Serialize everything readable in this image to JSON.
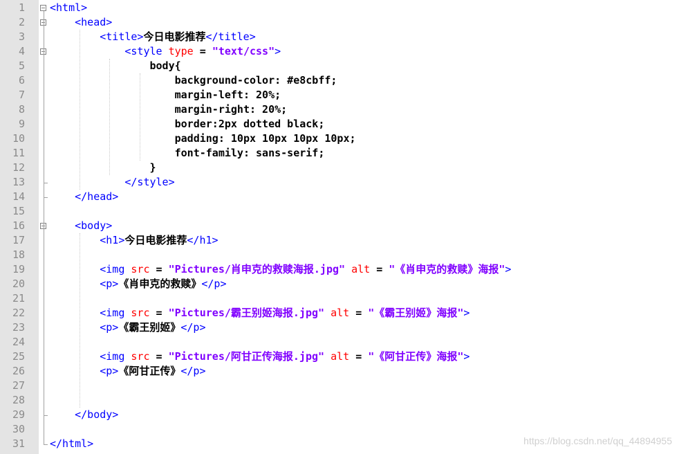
{
  "editor": {
    "lines": [
      {
        "n": "1",
        "segs": [
          [
            "tag",
            "<html>"
          ]
        ]
      },
      {
        "n": "2",
        "segs": [
          [
            "sp",
            "    "
          ],
          [
            "tag",
            "<head>"
          ]
        ]
      },
      {
        "n": "3",
        "segs": [
          [
            "sp",
            "        "
          ],
          [
            "tag",
            "<title>"
          ],
          [
            "txt",
            "今日电影推荐"
          ],
          [
            "tag",
            "</title>"
          ]
        ]
      },
      {
        "n": "4",
        "segs": [
          [
            "sp",
            "            "
          ],
          [
            "tag",
            "<style "
          ],
          [
            "attr",
            "type"
          ],
          [
            "css",
            " = "
          ],
          [
            "str",
            "\"text/css\""
          ],
          [
            "tag",
            ">"
          ]
        ]
      },
      {
        "n": "5",
        "segs": [
          [
            "sp",
            "                "
          ],
          [
            "css",
            "body{"
          ]
        ]
      },
      {
        "n": "6",
        "segs": [
          [
            "sp",
            "                    "
          ],
          [
            "css",
            "background-color: #e8cbff;"
          ]
        ]
      },
      {
        "n": "7",
        "segs": [
          [
            "sp",
            "                    "
          ],
          [
            "css",
            "margin-left: 20%;"
          ]
        ]
      },
      {
        "n": "8",
        "segs": [
          [
            "sp",
            "                    "
          ],
          [
            "css",
            "margin-right: 20%;"
          ]
        ]
      },
      {
        "n": "9",
        "segs": [
          [
            "sp",
            "                    "
          ],
          [
            "css",
            "border:2px dotted black;"
          ]
        ]
      },
      {
        "n": "10",
        "segs": [
          [
            "sp",
            "                    "
          ],
          [
            "css",
            "padding: 10px 10px 10px 10px;"
          ]
        ]
      },
      {
        "n": "11",
        "segs": [
          [
            "sp",
            "                    "
          ],
          [
            "css",
            "font-family: sans-serif;"
          ]
        ]
      },
      {
        "n": "12",
        "segs": [
          [
            "sp",
            "                "
          ],
          [
            "css",
            "}"
          ]
        ]
      },
      {
        "n": "13",
        "segs": [
          [
            "sp",
            "            "
          ],
          [
            "tag",
            "</style>"
          ]
        ]
      },
      {
        "n": "14",
        "segs": [
          [
            "sp",
            "    "
          ],
          [
            "tag",
            "</head>"
          ]
        ]
      },
      {
        "n": "15",
        "segs": []
      },
      {
        "n": "16",
        "segs": [
          [
            "sp",
            "    "
          ],
          [
            "tag",
            "<body>"
          ]
        ]
      },
      {
        "n": "17",
        "segs": [
          [
            "sp",
            "        "
          ],
          [
            "tag",
            "<h1>"
          ],
          [
            "txt",
            "今日电影推荐"
          ],
          [
            "tag",
            "</h1>"
          ]
        ]
      },
      {
        "n": "18",
        "segs": []
      },
      {
        "n": "19",
        "segs": [
          [
            "sp",
            "        "
          ],
          [
            "tag",
            "<img "
          ],
          [
            "attr",
            "src"
          ],
          [
            "css",
            " = "
          ],
          [
            "str",
            "\"Pictures/肖申克的救赎海报.jpg\""
          ],
          [
            "css",
            " "
          ],
          [
            "attr",
            "alt"
          ],
          [
            "css",
            " = "
          ],
          [
            "str",
            "\"《肖申克的救赎》海报\""
          ],
          [
            "tag",
            ">"
          ]
        ]
      },
      {
        "n": "20",
        "segs": [
          [
            "sp",
            "        "
          ],
          [
            "tag",
            "<p>"
          ],
          [
            "txt",
            "《肖申克的救赎》"
          ],
          [
            "tag",
            "</p>"
          ]
        ]
      },
      {
        "n": "21",
        "segs": []
      },
      {
        "n": "22",
        "segs": [
          [
            "sp",
            "        "
          ],
          [
            "tag",
            "<img "
          ],
          [
            "attr",
            "src"
          ],
          [
            "css",
            " = "
          ],
          [
            "str",
            "\"Pictures/霸王别姬海报.jpg\""
          ],
          [
            "css",
            " "
          ],
          [
            "attr",
            "alt"
          ],
          [
            "css",
            " = "
          ],
          [
            "str",
            "\"《霸王别姬》海报\""
          ],
          [
            "tag",
            ">"
          ]
        ]
      },
      {
        "n": "23",
        "segs": [
          [
            "sp",
            "        "
          ],
          [
            "tag",
            "<p>"
          ],
          [
            "txt",
            "《霸王别姬》"
          ],
          [
            "tag",
            "</p>"
          ]
        ]
      },
      {
        "n": "24",
        "segs": []
      },
      {
        "n": "25",
        "segs": [
          [
            "sp",
            "        "
          ],
          [
            "tag",
            "<img "
          ],
          [
            "attr",
            "src"
          ],
          [
            "css",
            " = "
          ],
          [
            "str",
            "\"Pictures/阿甘正传海报.jpg\""
          ],
          [
            "css",
            " "
          ],
          [
            "attr",
            "alt"
          ],
          [
            "css",
            " = "
          ],
          [
            "str",
            "\"《阿甘正传》海报\""
          ],
          [
            "tag",
            ">"
          ]
        ]
      },
      {
        "n": "26",
        "segs": [
          [
            "sp",
            "        "
          ],
          [
            "tag",
            "<p>"
          ],
          [
            "txt",
            "《阿甘正传》"
          ],
          [
            "tag",
            "</p>"
          ]
        ]
      },
      {
        "n": "27",
        "segs": []
      },
      {
        "n": "28",
        "segs": []
      },
      {
        "n": "29",
        "segs": [
          [
            "sp",
            "    "
          ],
          [
            "tag",
            "</body>"
          ]
        ]
      },
      {
        "n": "30",
        "segs": []
      },
      {
        "n": "31",
        "segs": [
          [
            "tag",
            "</html>"
          ]
        ]
      }
    ],
    "fold_markers": [
      "1",
      "2",
      "4",
      "16"
    ]
  },
  "watermark": "https://blog.csdn.net/qq_44894955",
  "colors": {
    "tag": "#0000ff",
    "attribute": "#ff0000",
    "string": "#8000ff",
    "gutter": "#e4e4e4"
  }
}
